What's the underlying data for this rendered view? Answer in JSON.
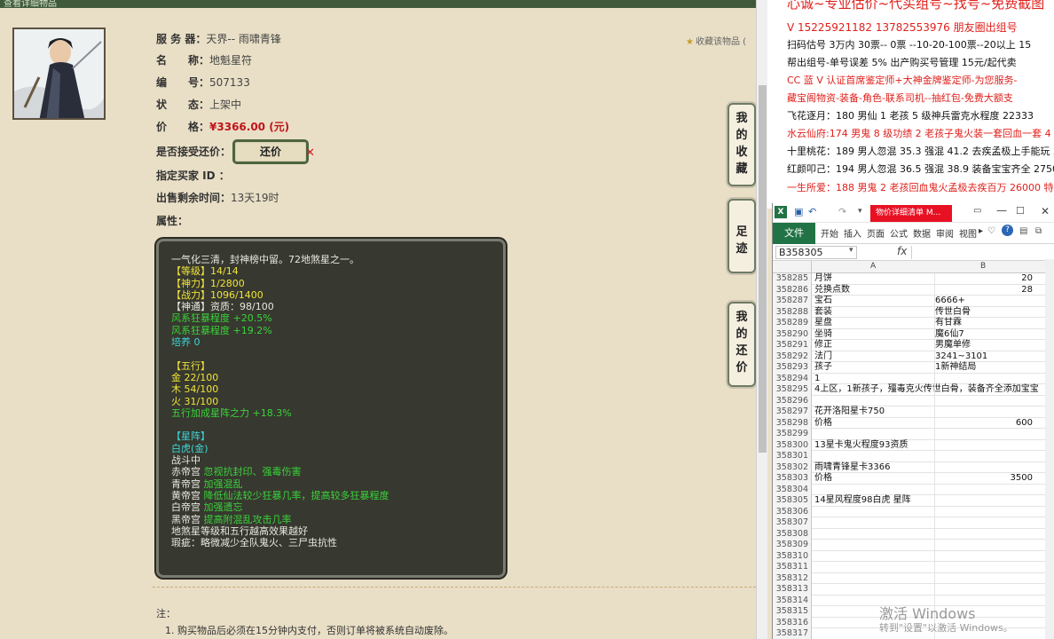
{
  "web": {
    "topbar_text": "查看详细物品",
    "fields": [
      {
        "label": "服 务 器：",
        "value": "天界-- 雨啸青锋"
      },
      {
        "label": "名　　称：",
        "value": "地魁星符"
      },
      {
        "label": "编　　号：",
        "value": "507133"
      },
      {
        "label": "状　　态：",
        "value": "上架中"
      }
    ],
    "price_label": "价　　格：",
    "price_value": "¥3366.00 (元)",
    "accept_counter_label": "是否接受还价：",
    "counter_button": "还价",
    "buyer_id_label": "指定买家 ID ：",
    "remaining_label": "出售剩余时间：",
    "remaining_value": "13天19时",
    "attr_label": "属性：",
    "favorite_link": "收藏该物品 (",
    "side_tabs": [
      "我的收藏",
      "足迹",
      "我的还价"
    ],
    "note_label": "注：",
    "note_item": "1. 购买物品后必须在15分钟内支付，否则订单将被系统自动废除。",
    "attributes": [
      {
        "text": "一气化三清，封神榜中留。72地煞星之一。",
        "color": "white"
      },
      {
        "text": "【等级】14/14",
        "color": "yellow"
      },
      {
        "text": "【神力】1/2800",
        "color": "yellow"
      },
      {
        "text": "【战力】1096/1400",
        "color": "yellow"
      },
      {
        "text": "【神通】资质：98/100",
        "color": "white"
      },
      {
        "text": "风系狂暴程度 +20.5%",
        "color": "green"
      },
      {
        "text": "风系狂暴程度 +19.2%",
        "color": "green"
      },
      {
        "text": "培养 0",
        "color": "cyan"
      },
      {
        "text": "",
        "color": "white"
      },
      {
        "text": "【五行】",
        "color": "yellow"
      },
      {
        "text": "金 22/100",
        "color": "yellow"
      },
      {
        "text": "木 54/100",
        "color": "yellow"
      },
      {
        "text": "火 31/100",
        "color": "yellow"
      },
      {
        "text": "五行加成星阵之力 +18.3%",
        "color": "green"
      },
      {
        "text": "",
        "color": "white"
      },
      {
        "text": "【星阵】",
        "color": "cyan"
      },
      {
        "text": "白虎(金)",
        "color": "cyan"
      },
      {
        "text": "战斗中",
        "color": "white"
      },
      {
        "text": "赤帝宫 忽视抗封印、强毒伤害",
        "color": "white",
        "tail_color": "green"
      },
      {
        "text": "青帝宫 加强混乱",
        "color": "white",
        "tail_color": "green"
      },
      {
        "text": "黄帝宫 降低仙法较少狂暴几率，提高较多狂暴程度",
        "color": "white",
        "tail_color": "green"
      },
      {
        "text": "白帝宫 加强遗忘",
        "color": "white",
        "tail_color": "green"
      },
      {
        "text": "黑帝宫 提高附混乱攻击几率",
        "color": "white",
        "tail_color": "green"
      },
      {
        "text": "地煞星等级和五行越高效果越好",
        "color": "white"
      },
      {
        "text": "瑕疵：略微减少全队鬼火、三尸虫抗性",
        "color": "white"
      }
    ]
  },
  "ad": {
    "lines": [
      {
        "text": "心诚~专业估价~代买组号~找号~免费截图",
        "color": "red",
        "size": 15
      },
      {
        "text": "V 15225921182   13782553976 朋友圈出组号",
        "color": "red",
        "size": 12
      },
      {
        "text": "扫码估号 3万内 30票--        0票  --10-20-100票--20以上 15",
        "color": "blk"
      },
      {
        "text": "帮出组号-单号误差 5%  出产购买号管理 15元/起代卖",
        "color": "blk"
      },
      {
        "text": "CC 蓝 V 认证首席鉴定师+大神金牌鉴定师-为您服务-",
        "color": "red"
      },
      {
        "text": "藏宝阁物资-装备-角色-联系司机--抽红包-免费大额支",
        "color": "red"
      },
      {
        "text": "飞花逐月：180 男仙 1 老孩 5 级神兵雷克水程度 22333",
        "color": "blk"
      },
      {
        "text": "水云仙府:174 男鬼 8 级功绩 2 老孩子鬼火装一套回血一套 4",
        "color": "red"
      },
      {
        "text": "十里桃花：189 男人忽混 35.3 强混 41.2 去疾孟极上手能玩 2",
        "color": "blk"
      },
      {
        "text": "红颜叩己：194 男人忽混 36.5 强混 38.9 装备宝宝齐全 27500",
        "color": "blk"
      },
      {
        "text": "一生所爱：188 男鬼 2 老孩回血鬼火孟极去疾百万 26000 特",
        "color": "red"
      }
    ]
  },
  "excel": {
    "doc_title": "物价详细清单 M...",
    "ribbon_tabs": [
      "文件",
      "开始",
      "插入",
      "页面",
      "公式",
      "数据",
      "审阅",
      "视图"
    ],
    "name_box": "B358305",
    "fx": "fx",
    "col_a": "A",
    "col_b": "B",
    "rows": [
      {
        "n": "358285",
        "a": "月饼",
        "b": "20",
        "num": true
      },
      {
        "n": "358286",
        "a": "兑换点数",
        "b": "28",
        "num": true
      },
      {
        "n": "358287",
        "a": "宝石",
        "b": "6666+"
      },
      {
        "n": "358288",
        "a": "套装",
        "b": "传世白骨"
      },
      {
        "n": "358289",
        "a": "星盘",
        "b": "有甘霖"
      },
      {
        "n": "358290",
        "a": "坐骑",
        "b": "魔6仙7"
      },
      {
        "n": "358291",
        "a": "修正",
        "b": "男魔单修"
      },
      {
        "n": "358292",
        "a": "法门",
        "b": "3241~3101"
      },
      {
        "n": "358293",
        "a": "孩子",
        "b": "1新神结局"
      },
      {
        "n": "358294",
        "a": "                                   1",
        "b": ""
      },
      {
        "n": "358295",
        "a": "4上区，1新孩子，殭毒克火传世白骨，装备齐全添加宝宝",
        "b": "",
        "spill": true
      },
      {
        "n": "358296",
        "a": "",
        "b": ""
      },
      {
        "n": "358297",
        "a": "花开洛阳星卡750",
        "b": ""
      },
      {
        "n": "358298",
        "a": "价格",
        "b": "600",
        "num": true
      },
      {
        "n": "358299",
        "a": "",
        "b": ""
      },
      {
        "n": "358300",
        "a": "13星卡鬼火程度93资质",
        "b": ""
      },
      {
        "n": "358301",
        "a": "",
        "b": ""
      },
      {
        "n": "358302",
        "a": "雨啸青锋星卡3366",
        "b": ""
      },
      {
        "n": "358303",
        "a": "价格",
        "b": "3500",
        "num": true
      },
      {
        "n": "358304",
        "a": "",
        "b": ""
      },
      {
        "n": "358305",
        "a": "14星风程度98白虎 星阵",
        "b": ""
      },
      {
        "n": "358306",
        "a": "",
        "b": ""
      },
      {
        "n": "358307",
        "a": "",
        "b": ""
      },
      {
        "n": "358308",
        "a": "",
        "b": ""
      },
      {
        "n": "358309",
        "a": "",
        "b": ""
      },
      {
        "n": "358310",
        "a": "",
        "b": ""
      },
      {
        "n": "358311",
        "a": "",
        "b": ""
      },
      {
        "n": "358312",
        "a": "",
        "b": ""
      },
      {
        "n": "358313",
        "a": "",
        "b": ""
      },
      {
        "n": "358314",
        "a": "",
        "b": ""
      },
      {
        "n": "358315",
        "a": "",
        "b": ""
      },
      {
        "n": "358316",
        "a": "",
        "b": ""
      },
      {
        "n": "358317",
        "a": "",
        "b": ""
      }
    ]
  },
  "watermark": {
    "title": "激活 Windows",
    "sub": "转到\"设置\"以激活 Windows。"
  }
}
